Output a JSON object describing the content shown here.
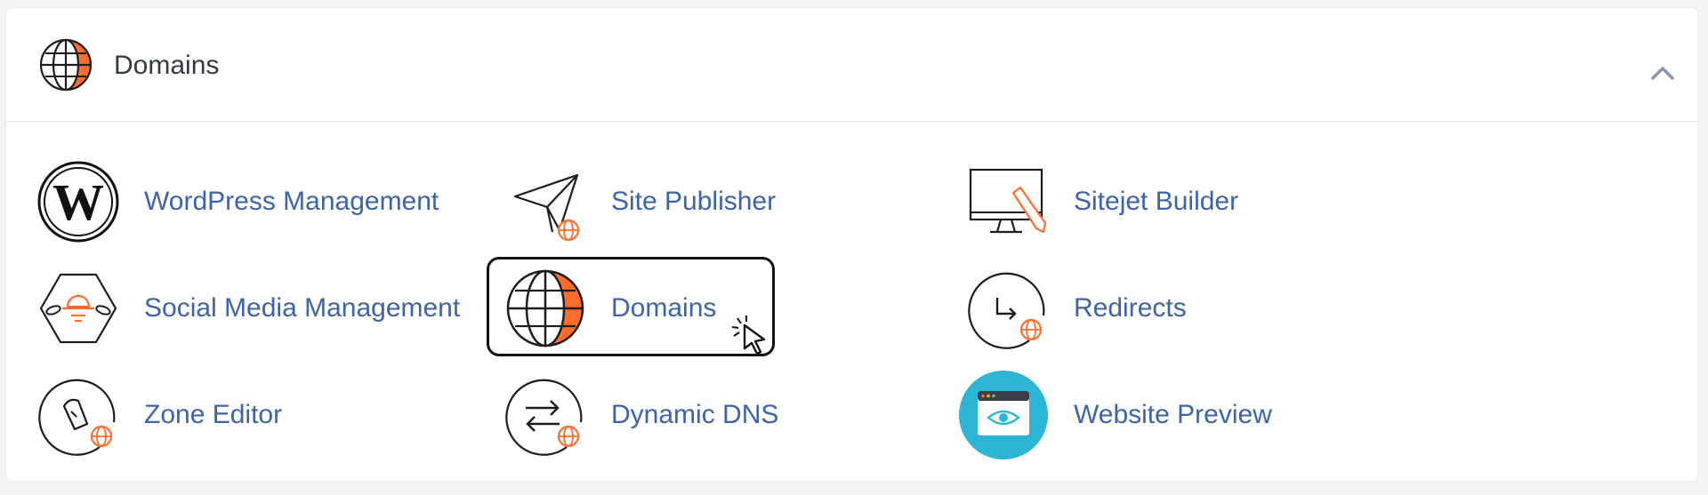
{
  "section": {
    "title": "Domains",
    "collapse_icon": "chevron-up-icon"
  },
  "tools": [
    {
      "label": "WordPress Management",
      "icon": "wordpress-icon"
    },
    {
      "label": "Site Publisher",
      "icon": "paper-plane-globe-icon"
    },
    {
      "label": "Sitejet Builder",
      "icon": "monitor-pencil-icon"
    },
    {
      "label": "Social Media Management",
      "icon": "social-media-hexagon-icon"
    },
    {
      "label": "Domains",
      "icon": "globe-icon"
    },
    {
      "label": "Redirects",
      "icon": "redirect-arrow-globe-icon"
    },
    {
      "label": "Zone Editor",
      "icon": "zone-editor-globe-icon"
    },
    {
      "label": "Dynamic DNS",
      "icon": "swap-arrows-globe-icon"
    },
    {
      "label": "Website Preview",
      "icon": "browser-eye-icon"
    }
  ],
  "colors": {
    "accent_orange": "#ff6c2c",
    "link_blue": "#3c64a8",
    "preview_teal": "#2cb5d4"
  }
}
